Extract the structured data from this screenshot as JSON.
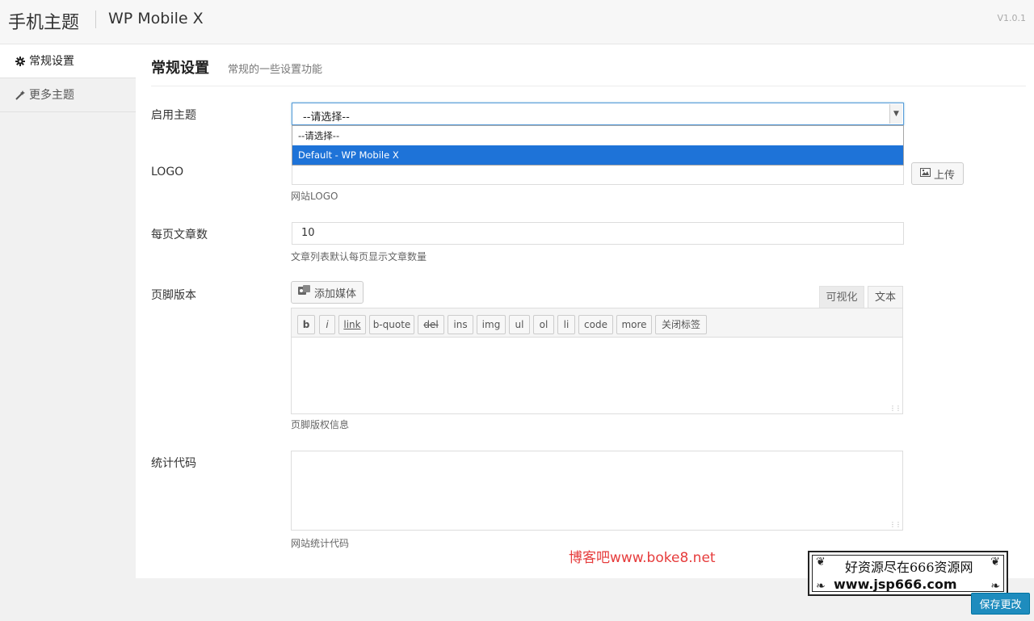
{
  "header": {
    "title": "手机主题",
    "subtitle": "WP Mobile X",
    "version": "V1.0.1"
  },
  "sidebar": {
    "items": [
      {
        "label": "常规设置",
        "icon": "gear-icon",
        "active": true
      },
      {
        "label": "更多主题",
        "icon": "wand-icon",
        "active": false
      }
    ]
  },
  "page": {
    "title": "常规设置",
    "description": "常规的一些设置功能"
  },
  "fields": {
    "theme": {
      "label": "启用主题",
      "value": "--请选择--",
      "options": [
        "--请选择--",
        "Default - WP Mobile X"
      ],
      "highlighted": "Default - WP Mobile X"
    },
    "logo": {
      "label": "LOGO",
      "value": "",
      "help": "网站LOGO",
      "upload_label": "上传"
    },
    "per_page": {
      "label": "每页文章数",
      "value": "10",
      "help": "文章列表默认每页显示文章数量"
    },
    "footer": {
      "label": "页脚版本",
      "media_label": "添加媒体",
      "tabs": [
        "可视化",
        "文本"
      ],
      "quicktags": [
        "b",
        "i",
        "link",
        "b-quote",
        "del",
        "ins",
        "img",
        "ul",
        "ol",
        "li",
        "code",
        "more",
        "关闭标签"
      ],
      "help": "页脚版权信息"
    },
    "stats": {
      "label": "统计代码",
      "help": "网站统计代码"
    }
  },
  "save_label": "保存更改",
  "watermarks": {
    "red": "博客吧www.boke8.net",
    "box_line1": "好资源尽在666资源网",
    "box_line2": "www.jsp666.com"
  },
  "colors": {
    "primary": "#1e8cbe",
    "select_highlight": "#1e73d8",
    "watermark_red": "#e63c3c"
  }
}
